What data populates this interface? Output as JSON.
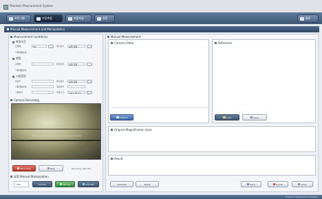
{
  "window": {
    "title": "Phantom Measurement System"
  },
  "nav": {
    "buttons": [
      {
        "label": "프로그램",
        "active": false
      },
      {
        "label": "수동측정",
        "active": true
      },
      {
        "label": "자동측정",
        "active": false
      },
      {
        "label": "설정",
        "active": false
      }
    ],
    "exit_label": "종료"
  },
  "section_title": "Manual Measurement and Manipulation",
  "left": {
    "conditions_title": "Measurement conditions",
    "group1": {
      "title": "측정조건",
      "row1_label": "모델명",
      "row1_value": "M5",
      "row1_label2": "확인장치",
      "row1_value2": "실제 모델",
      "row2_label": "사용제품번호"
    },
    "group2": {
      "title": "팬텀",
      "row1_label": "모델명",
      "row1_label2": "확인장치",
      "row1_value2": "실제 모델",
      "row2_label": "사용제품번호"
    },
    "group3": {
      "title": "시험환경",
      "row1_label": "측정자",
      "row1_label2": "확인장치",
      "row1_value2": "실제 모델",
      "row2_label": "사용제품번호",
      "row2_label2": "측정위치",
      "row3_label": "시험일자",
      "row3_label2": "측정시간",
      "row3_value2": "2013-05-21"
    },
    "camera_title": "Camera Recording",
    "recording_label": "Recording",
    "stop_label": "Stop",
    "recording_status": "Recording Standby",
    "led_title": "LED Manual Manipulation",
    "led_value": "100",
    "led_control_label": "Control",
    "led_on_label": "LED ON",
    "led_off_label": "LED OFF"
  },
  "right": {
    "manual_title": "Manual Measurement",
    "camera_video_title": "Camera Video",
    "capture_label": "Capture",
    "reference_title": "Reference",
    "load_label": "Load",
    "save_label": "Save",
    "magnification_title": "Original Magnification Area",
    "result_title": "Result",
    "calc_label": "Calculate",
    "reset_label": "Reset",
    "save_btn_label": "Save",
    "cancel_label": "Cancel",
    "close_label": "Close"
  },
  "statusbar": {
    "text": "Phantom Measurement System"
  },
  "colors": {
    "navbar": "#4c6483",
    "accent": "#3a66a8",
    "panel": "#f3f5f8"
  }
}
